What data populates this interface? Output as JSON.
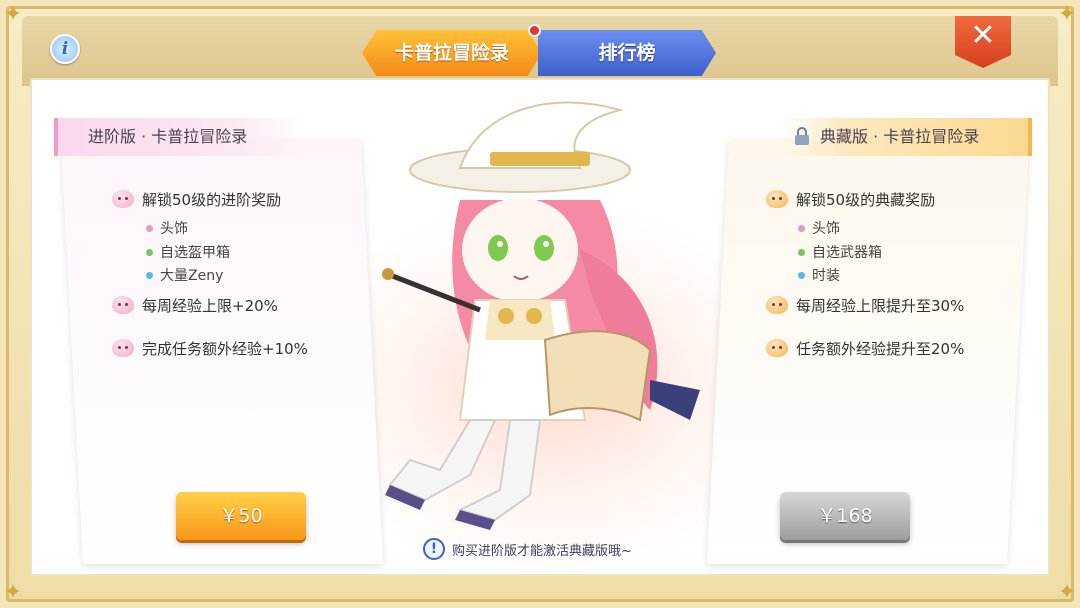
{
  "tabs": [
    {
      "label": "卡普拉冒险录",
      "active": true,
      "has_notification": true
    },
    {
      "label": "排行榜",
      "active": false
    }
  ],
  "header_buttons": {
    "info_icon": "info-icon",
    "close_icon": "close-icon"
  },
  "advanced_card": {
    "title": "进阶版 · 卡普拉冒险录",
    "features": [
      {
        "text": "解锁50级的进阶奖励",
        "sub_items": [
          "头饰",
          "自选盔甲箱",
          "大量Zeny"
        ]
      },
      {
        "text": "每周经验上限+20%"
      },
      {
        "text": "完成任务额外经验+10%"
      }
    ],
    "price": "￥50",
    "locked": false
  },
  "collector_card": {
    "title": "典藏版 · 卡普拉冒险录",
    "features": [
      {
        "text": "解锁50级的典藏奖励",
        "sub_items": [
          "头饰",
          "自选武器箱",
          "时装"
        ]
      },
      {
        "text": "每周经验上限提升至30%"
      },
      {
        "text": "任务额外经验提升至20%"
      }
    ],
    "price": "￥168",
    "locked": true
  },
  "notice": "购买进阶版才能激活典藏版哦~",
  "colors": {
    "active_tab": "#f58a15",
    "inactive_tab": "#3d5fcc",
    "gold_button": "#f79718",
    "disabled_button": "#9d9d9d",
    "sub_dot_1": "#e59ac0",
    "sub_dot_2": "#77c85a",
    "sub_dot_3": "#4fbde8"
  }
}
